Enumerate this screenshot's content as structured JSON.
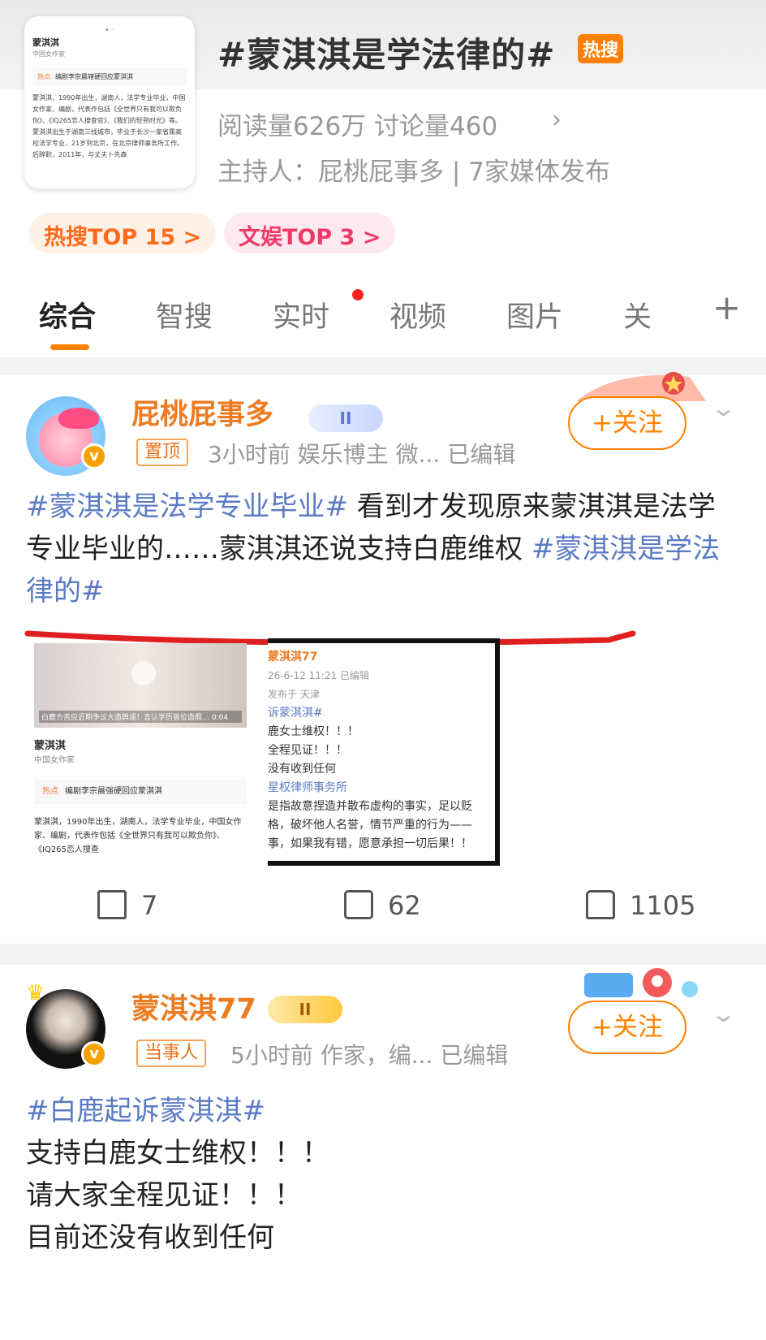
{
  "topic": {
    "title": "#蒙淇淇是学法律的#",
    "hot_badge": "热搜",
    "stats": "阅读量626万  讨论量460",
    "host": "主持人：屁桃屁事多 | 7家媒体发布",
    "pills": [
      "热搜TOP 15 >",
      "文娱TOP 3 >"
    ],
    "thumbnail": {
      "name": "蒙淇淇",
      "subtitle": "中国女作家",
      "hot_label": "热点",
      "hot_text": "编剧李宗晨辖硬回应蒙淇淇",
      "text": "蒙淇淇，1990年出生，湖南人，法学专业毕业，中国女作家、编剧，代表作包括《全世界只有我可以欺负你》、《IQ265恋人搜查官》、《我们的轻熟时光》等。蒙淇淇出生于湖南三线城市，毕业于长沙一家省属高校法学专业，21岁到北京，在北京律师事务所工作。后辞职，2011年，与丈夫卜先森"
    }
  },
  "tabs": {
    "items": [
      "综合",
      "智搜",
      "实时",
      "视频",
      "图片",
      "关"
    ],
    "plus": "+"
  },
  "posts": [
    {
      "username": "屁桃屁事多",
      "vip_level": "II",
      "tag": "置顶",
      "meta": "3小时前  娱乐博主 微...  已编辑",
      "follow": "+关注",
      "body_tag1": "#蒙淇淇是法学专业毕业#",
      "body_text": " 看到才发现原来蒙淇淇是法学专业毕业的……蒙淇淇还说支持白鹿维权 ",
      "body_tag2": "#蒙淇淇是学法律的#",
      "image1": {
        "caption": "白鹿方否应近期争议大造舆谣！言认学历曾位造假… 0:04",
        "name": "蒙淇淇",
        "subtitle": "中国女作家",
        "hot_label": "热点",
        "hot_text": "编剧李宗晨强硬回应蒙淇淇",
        "text": "蒙淇淇，1990年出生，湖南人，法学专业毕业，中国女作家、编剧，代表作包括《全世界只有我可以欺负你》、《IQ265恋人搜查"
      },
      "image2": {
        "user": "蒙淇淇77",
        "time": "26-6-12 11:21  已编辑",
        "from": "发布于 天津",
        "lines": [
          "诉蒙淇淇#",
          "鹿女士维权！！！",
          "全程见证！！！",
          "没有收到任何",
          "星权律师事务所",
          "是指故意捏造并散布虚构的事实，足以贬",
          "格，破坏他人名誉，情节严重的行为——",
          "事，如果我有错，愿意承担一切后果！！"
        ]
      },
      "shares": "7",
      "comments": "62",
      "likes": "1105"
    },
    {
      "username": "蒙淇淇77",
      "vip_level": "II",
      "tag": "当事人",
      "meta": "5小时前  作家，编...  已编辑",
      "follow": "+关注",
      "body_tag": "#白鹿起诉蒙淇淇#",
      "lines": [
        "支持白鹿女士维权！！！",
        "请大家全程见证！！！",
        "目前还没有收到任何"
      ]
    }
  ],
  "colors": {
    "accent": "#ff8200",
    "hashtag": "#5b7bc4",
    "username": "#ec7c22"
  }
}
